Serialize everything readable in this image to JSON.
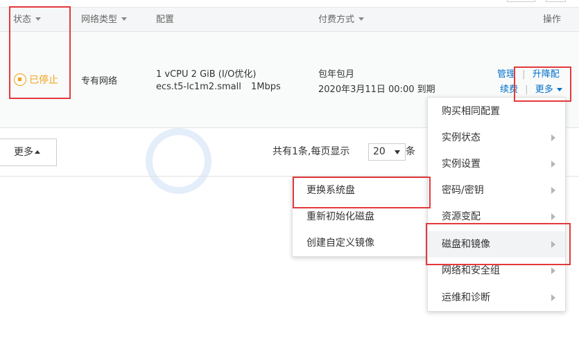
{
  "table": {
    "headers": {
      "status": "状态",
      "network": "网络类型",
      "config": "配置",
      "billing": "付费方式",
      "actions": "操作"
    },
    "row": {
      "status": "已停止",
      "network": "专有网络",
      "config_line1": "1 vCPU 2 GiB (I/O优化)",
      "config_line2": "ecs.t5-lc1m2.small",
      "bandwidth": "1Mbps",
      "billing_type": "包年包月",
      "expiry": "2020年3月11日 00:00 到期",
      "action_manage": "管理",
      "action_upgrade": "升降配",
      "action_renew": "续费",
      "action_more": "更多"
    }
  },
  "footer": {
    "more_label": "更多",
    "pager_prefix": "共有1条,每页显示",
    "page_size": "20",
    "pager_suffix": "条"
  },
  "menu_main": [
    {
      "label": "购买相同配置",
      "submenu": false
    },
    {
      "label": "实例状态",
      "submenu": true
    },
    {
      "label": "实例设置",
      "submenu": true
    },
    {
      "label": "密码/密钥",
      "submenu": true
    },
    {
      "label": "资源变配",
      "submenu": true
    },
    {
      "label": "磁盘和镜像",
      "submenu": true
    },
    {
      "label": "网络和安全组",
      "submenu": true
    },
    {
      "label": "运维和诊断",
      "submenu": true
    }
  ],
  "menu_sub": [
    {
      "label": "更换系统盘"
    },
    {
      "label": "重新初始化磁盘"
    },
    {
      "label": "创建自定义镜像"
    }
  ],
  "colors": {
    "link": "#0070cc",
    "stopped": "#f0a21b",
    "highlight": "#e3393c"
  }
}
